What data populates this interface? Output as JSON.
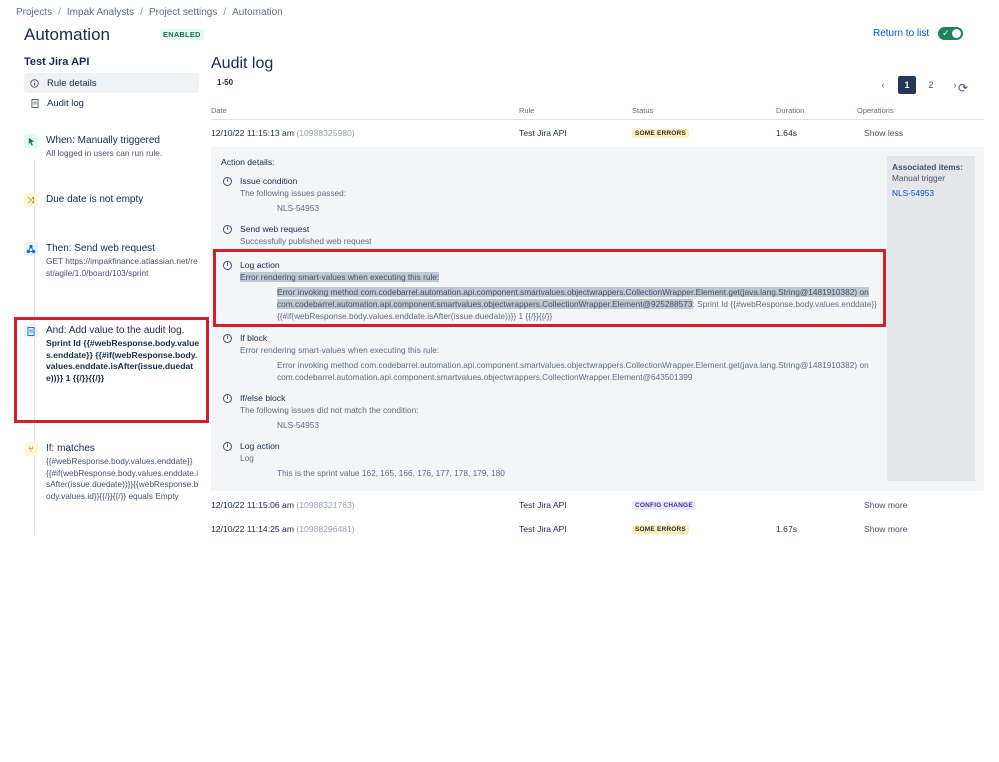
{
  "breadcrumb": {
    "items": [
      "Projects",
      "Impak Analysts",
      "Project settings",
      "Automation"
    ]
  },
  "header": {
    "title": "Automation",
    "status": "ENABLED",
    "return_label": "Return to list"
  },
  "rule": {
    "name": "Test Jira API"
  },
  "sidebar": {
    "items": [
      {
        "label": "Rule details",
        "icon": "info-icon"
      },
      {
        "label": "Audit log",
        "icon": "document-icon"
      }
    ]
  },
  "steps": {
    "trigger": {
      "title": "When: Manually triggered",
      "body": "All logged in users can run rule."
    },
    "condition": {
      "title": "Due date is not empty"
    },
    "web_request": {
      "title": "Then: Send web request",
      "body": "GET https://impakfinance.atlassian.net/rest/agile/1.0/board/103/sprint"
    },
    "audit": {
      "title": "And: Add value to the audit log.",
      "body": "Sprint Id {{#webResponse.body.values.enddate}} {{#if(webResponse.body.values.enddate.isAfter(issue.duedate))}} 1 {{/}}{{/}}"
    },
    "if_matches": {
      "title": "If: matches",
      "body": "{{#webResponse.body.values.enddate}}{{#if(webResponse.body.values.enddate.isAfter(issue.duedate))}}{{webResponse.body.values.id}}{{/}}{{/}} equals Empty"
    }
  },
  "main": {
    "title": "Audit log",
    "range": "1-50",
    "pager": {
      "pages": [
        "1",
        "2"
      ],
      "current": "1"
    },
    "columns": [
      "Date",
      "Rule",
      "Status",
      "Duration",
      "Operations"
    ],
    "rows": [
      {
        "date": "12/10/22 11:15:13 am",
        "id": "(10988325980)",
        "rule": "Test Jira API",
        "status": "SOME ERRORS",
        "duration": "1.64s",
        "op": "Show less"
      },
      {
        "date": "12/10/22 11:15:06 am",
        "id": "(10988321763)",
        "rule": "Test Jira API",
        "status": "CONFIG CHANGE",
        "duration": "",
        "op": "Show more"
      },
      {
        "date": "12/10/22 11:14:25 am",
        "id": "(10988296481)",
        "rule": "Test Jira API",
        "status": "SOME ERRORS",
        "duration": "1.67s",
        "op": "Show more"
      }
    ],
    "details": {
      "label": "Action details:",
      "associated": {
        "title": "Associated items:",
        "sub": "Manual trigger",
        "link": "NLS-54953"
      },
      "actions": [
        {
          "name": "Issue condition",
          "desc": "The following issues passed:",
          "value": "NLS-54953"
        },
        {
          "name": "Send web request",
          "desc": "Successfully published web request",
          "value": ""
        },
        {
          "name": "Log action",
          "desc": "Error rendering smart-values when executing this rule:",
          "value_hl": "Error invoking method com.codebarrel.automation.api.component.smartvalues.objectwrappers.CollectionWrapper.Element.get(java.lang.String@1481910382) on com.codebarrel.automation.api.component.smartvalues.objectwrappers.CollectionWrapper.Element@925288573",
          "value_rest": ": Sprint Id {{#webResponse.body.values.enddate}}",
          "value_tail": "{{#if(webResponse.body.values.enddate.isAfter(issue.duedate))}} 1 {{/}}{{/}}"
        },
        {
          "name": "If block",
          "desc": "Error rendering smart-values when executing this rule:",
          "value": "Error invoking method com.codebarrel.automation.api.component.smartvalues.objectwrappers.CollectionWrapper.Element.get(java.lang.String@1481910382) on com.codebarrel.automation.api.component.smartvalues.objectwrappers.CollectionWrapper.Element@643501399"
        },
        {
          "name": "If/else block",
          "desc": "The following issues did not match the condition:",
          "value": "NLS-54953"
        },
        {
          "name": "Log action",
          "desc": "Log",
          "value": "This is the sprint value 162, 165, 166, 176, 177, 178, 179, 180"
        }
      ]
    }
  },
  "colors": {
    "accent": "#0052cc",
    "highlight_border": "#d0202b",
    "toggle_on": "#1f845a"
  }
}
